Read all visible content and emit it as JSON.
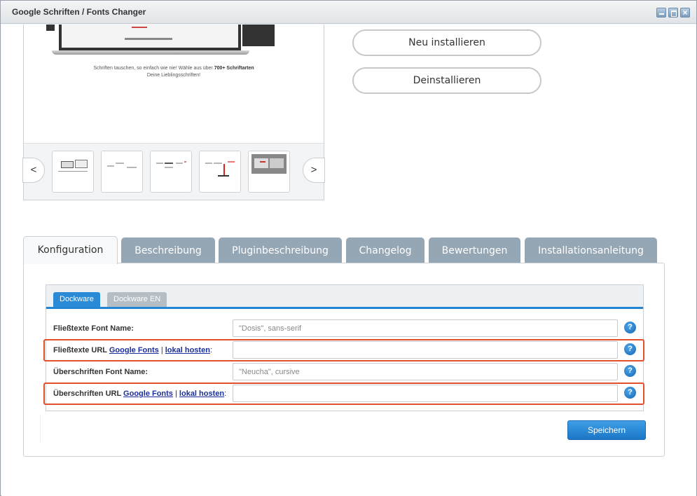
{
  "window": {
    "title": "Google Schriften / Fonts Changer"
  },
  "slider": {
    "caption_line1": "Schriften tauschen, so einfach wie nie! Wähle aus über ",
    "caption_bold": "700+ Schriftarten",
    "caption_line2": "Deine Lieblingsschriften!",
    "prev_label": "<",
    "next_label": ">"
  },
  "actions": {
    "reinstall_label": "Neu installieren",
    "uninstall_label": "Deinstallieren"
  },
  "tabs": [
    {
      "label": "Konfiguration"
    },
    {
      "label": "Beschreibung"
    },
    {
      "label": "Pluginbeschreibung"
    },
    {
      "label": "Changelog"
    },
    {
      "label": "Bewertungen"
    },
    {
      "label": "Installationsanleitung"
    }
  ],
  "subtabs": [
    {
      "label": "Dockware"
    },
    {
      "label": "Dockware EN"
    }
  ],
  "form": {
    "body_font_name": {
      "label": "Fließtexte Font Name:",
      "value": "\"Dosis\", sans-serif"
    },
    "body_url": {
      "label_prefix": "Fließtexte URL ",
      "link_google": "Google Fonts",
      "separator": " | ",
      "link_local": "lokal hosten",
      "label_suffix": ":",
      "value": ""
    },
    "heading_font_name": {
      "label": "Überschriften Font Name:",
      "value": "\"Neucha\", cursive"
    },
    "heading_url": {
      "label_prefix": "Überschriften URL ",
      "link_google": "Google Fonts",
      "separator": " | ",
      "link_local": "lokal hosten",
      "label_suffix": ":",
      "value": ""
    },
    "help_glyph": "?"
  },
  "save_label": "Speichern",
  "colors": {
    "accent": "#2286d4",
    "tab_inactive": "#95a6b5",
    "highlight": "#e0512b",
    "link": "#1a2f9c"
  }
}
